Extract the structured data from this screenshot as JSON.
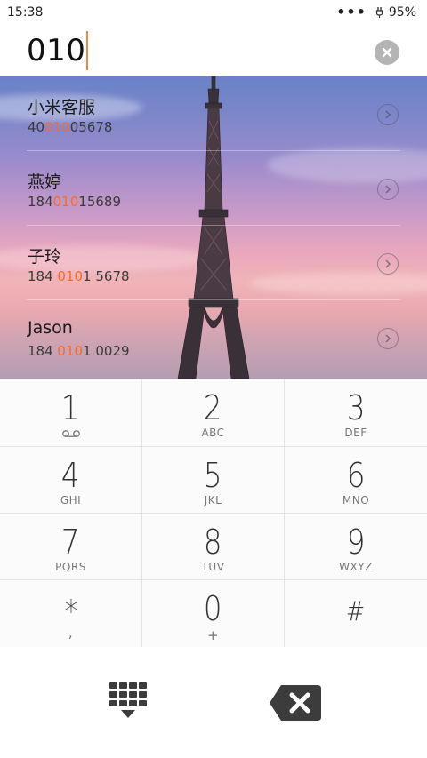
{
  "status_bar": {
    "time": "15:38",
    "overflow_indicator": "•••",
    "battery": "95%"
  },
  "dialer": {
    "number": "010"
  },
  "contacts": [
    {
      "name": "小米客服",
      "number_prefix": "40",
      "number_match": "010",
      "number_suffix": "05678"
    },
    {
      "name": "燕婷",
      "number_prefix": "184",
      "number_match": "010",
      "number_suffix": "15689"
    },
    {
      "name": "子玲",
      "number_prefix": "184 ",
      "number_match": "010",
      "number_suffix": "1 5678"
    },
    {
      "name": "Jason",
      "number_prefix": "184 ",
      "number_match": "010",
      "number_suffix": "1 0029"
    }
  ],
  "keypad": [
    {
      "digit": "1",
      "letters": ""
    },
    {
      "digit": "2",
      "letters": "ABC"
    },
    {
      "digit": "3",
      "letters": "DEF"
    },
    {
      "digit": "4",
      "letters": "GHI"
    },
    {
      "digit": "5",
      "letters": "JKL"
    },
    {
      "digit": "6",
      "letters": "MNO"
    },
    {
      "digit": "7",
      "letters": "PQRS"
    },
    {
      "digit": "8",
      "letters": "TUV"
    },
    {
      "digit": "9",
      "letters": "WXYZ"
    },
    {
      "digit": "*",
      "letters": ","
    },
    {
      "digit": "0",
      "letters": "+"
    },
    {
      "digit": "#",
      "letters": ""
    }
  ],
  "icons": {
    "clear": "close-icon",
    "contact_detail": "chevron-right-icon",
    "voicemail": "voicemail-icon",
    "dialpad": "dialpad-icon",
    "backspace": "backspace-icon"
  },
  "colors": {
    "match_highlight": "#ff6a1a",
    "cursor": "#f0883a",
    "key_background": "#fbfbfb",
    "divider": "#e4e4e4"
  }
}
